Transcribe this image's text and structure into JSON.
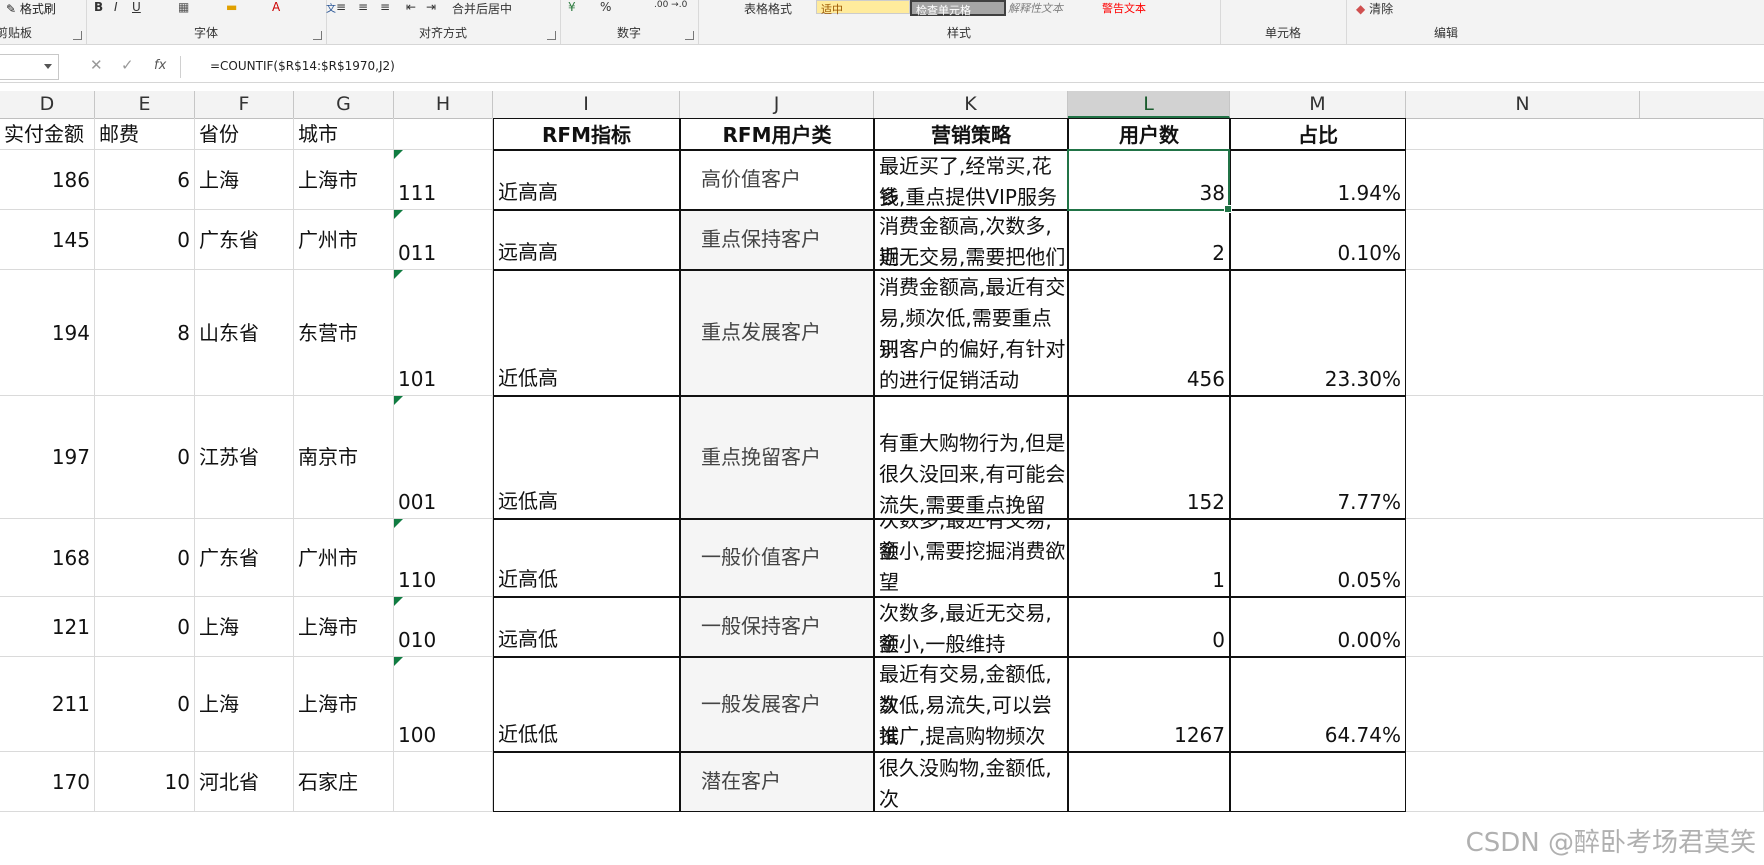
{
  "ribbon": {
    "clipboard": {
      "format_painter": "格式刷",
      "label": "剪贴板"
    },
    "font": {
      "label": "字体",
      "bold": "B",
      "italic": "I",
      "underline": "U"
    },
    "alignment": {
      "label": "对齐方式",
      "merge_center": "合并后居中"
    },
    "number": {
      "label": "数字",
      "percent": "%"
    },
    "styles": {
      "label": "样式",
      "table_format": "表格格式",
      "neutral": "适中",
      "check_cell": "检查单元格",
      "explanatory": "解释性文本",
      "warning": "警告文本"
    },
    "cells": {
      "label": "单元格"
    },
    "editing": {
      "label": "编辑",
      "clear": "清除"
    }
  },
  "formula_bar": {
    "cancel_icon": "✕",
    "confirm_icon": "✓",
    "fx_label": "fx",
    "formula": "=COUNTIF($R$14:$R$1970,J2)"
  },
  "columns": [
    "D",
    "E",
    "F",
    "G",
    "H",
    "I",
    "J",
    "K",
    "L",
    "M",
    "N"
  ],
  "header_row": {
    "D": "实付金额",
    "E": "邮费",
    "F": "省份",
    "G": "城市",
    "I": "RFM指标",
    "J": "RFM用户类",
    "K": "营销策略",
    "L": "用户数",
    "M": "占比"
  },
  "rows": [
    {
      "D": "186",
      "E": "6",
      "F": "上海",
      "G": "上海市",
      "H": "111",
      "I": "近高高",
      "J": "高价值客户",
      "K": [
        "最近买了,经常买,花钱",
        "多,重点提供VIP服务的"
      ],
      "L": "38",
      "M": "1.94%"
    },
    {
      "D": "145",
      "E": "0",
      "F": "广东省",
      "G": "广州市",
      "H": "011",
      "I": "远高高",
      "J": "重点保持客户",
      "K": [
        "消费金额高,次数多,近",
        "期无交易,需要把他们"
      ],
      "L": "2",
      "M": "0.10%"
    },
    {
      "D": "194",
      "E": "8",
      "F": "山东省",
      "G": "东营市",
      "H": "101",
      "I": "近低高",
      "J": "重点发展客户",
      "K": [
        "消费金额高,最近有交",
        "易,频次低,需要重点识",
        "别客户的偏好,有针对",
        "的进行促销活动"
      ],
      "L": "456",
      "M": "23.30%"
    },
    {
      "D": "197",
      "E": "0",
      "F": "江苏省",
      "G": "南京市",
      "H": "001",
      "I": "远低高",
      "J": "重点挽留客户",
      "K": [
        "有重大购物行为,但是",
        "很久没回来,有可能会",
        "流失,需要重点挽留"
      ],
      "L": "152",
      "M": "7.77%"
    },
    {
      "D": "168",
      "E": "0",
      "F": "广东省",
      "G": "广州市",
      "H": "110",
      "I": "近高低",
      "J": "一般价值客户",
      "K": [
        "次数多,最近有交易,金",
        "额小,需要挖掘消费欲",
        "望"
      ],
      "L": "1",
      "M": "0.05%"
    },
    {
      "D": "121",
      "E": "0",
      "F": "上海",
      "G": "上海市",
      "H": "010",
      "I": "远高低",
      "J": "一般保持客户",
      "K": [
        "次数多,最近无交易,金",
        "额小,一般维持"
      ],
      "L": "0",
      "M": "0.00%"
    },
    {
      "D": "211",
      "E": "0",
      "F": "上海",
      "G": "上海市",
      "H": "100",
      "I": "近低低",
      "J": "一般发展客户",
      "K": [
        "最近有交易,金额低,次",
        "数低,易流失,可以尝试",
        "推广,提高购物频次"
      ],
      "L": "1267",
      "M": "64.74%"
    },
    {
      "D": "170",
      "E": "10",
      "F": "河北省",
      "G": "石家庄",
      "H": "",
      "I": "",
      "J": "潜在客户",
      "K": [
        "很久没购物,金额低,次"
      ],
      "L": "",
      "M": ""
    }
  ],
  "watermark": "CSDN @醉卧考场君莫笑"
}
